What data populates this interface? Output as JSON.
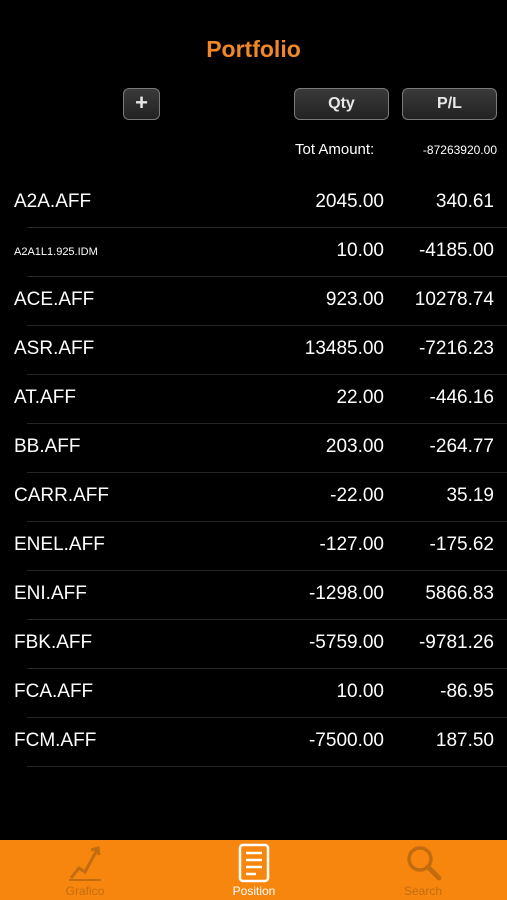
{
  "header": {
    "title": "Portfolio"
  },
  "toolbar": {
    "add_label": "+",
    "qty_label": "Qty",
    "pl_label": "P/L"
  },
  "totals": {
    "label": "Tot Amount:",
    "value": "-87263920.00"
  },
  "positions": [
    {
      "symbol": "A2A.AFF",
      "qty": "2045.00",
      "pl": "340.61"
    },
    {
      "symbol": "A2A1L1.925.IDM",
      "qty": "10.00",
      "pl": "-4185.00"
    },
    {
      "symbol": "ACE.AFF",
      "qty": "923.00",
      "pl": "10278.74"
    },
    {
      "symbol": "ASR.AFF",
      "qty": "13485.00",
      "pl": "-7216.23"
    },
    {
      "symbol": "AT.AFF",
      "qty": "22.00",
      "pl": "-446.16"
    },
    {
      "symbol": "BB.AFF",
      "qty": "203.00",
      "pl": "-264.77"
    },
    {
      "symbol": "CARR.AFF",
      "qty": "-22.00",
      "pl": "35.19"
    },
    {
      "symbol": "ENEL.AFF",
      "qty": "-127.00",
      "pl": "-175.62"
    },
    {
      "symbol": "ENI.AFF",
      "qty": "-1298.00",
      "pl": "5866.83"
    },
    {
      "symbol": "FBK.AFF",
      "qty": "-5759.00",
      "pl": "-9781.26"
    },
    {
      "symbol": "FCA.AFF",
      "qty": "10.00",
      "pl": "-86.95"
    },
    {
      "symbol": "FCM.AFF",
      "qty": "-7500.00",
      "pl": "187.50"
    }
  ],
  "tabbar": {
    "tabs": [
      {
        "label": "Grafico",
        "icon": "chart-icon",
        "active": false
      },
      {
        "label": "Position",
        "icon": "document-icon",
        "active": true
      },
      {
        "label": "Search",
        "icon": "search-icon",
        "active": false
      }
    ]
  },
  "colors": {
    "accent": "#f0882a",
    "tabbar": "#f7860f",
    "background": "#000000"
  }
}
